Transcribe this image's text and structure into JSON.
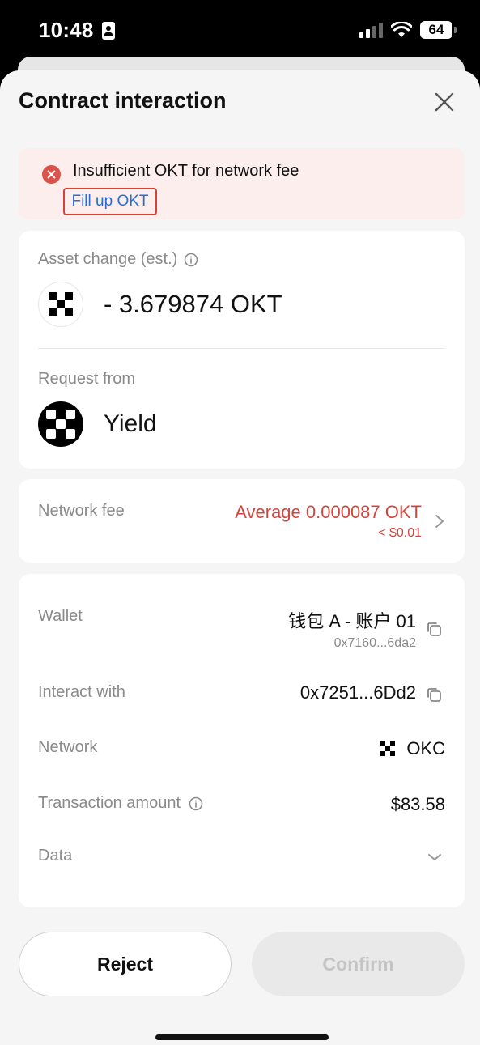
{
  "status_bar": {
    "time": "10:48",
    "battery": "64"
  },
  "header": {
    "title": "Contract interaction"
  },
  "alert": {
    "message": "Insufficient OKT for network fee",
    "link": "Fill up OKT"
  },
  "asset_change": {
    "label": "Asset change (est.)",
    "amount": "- 3.679874 OKT"
  },
  "request": {
    "label": "Request from",
    "name": "Yield"
  },
  "network_fee": {
    "label": "Network fee",
    "value": "Average 0.000087 OKT",
    "usd": "< $0.01"
  },
  "details": {
    "wallet_label": "Wallet",
    "wallet_name": "钱包 A - 账户 01",
    "wallet_address": "0x7160...6da2",
    "interact_label": "Interact with",
    "interact_value": "0x7251...6Dd2",
    "network_label": "Network",
    "network_value": "OKC",
    "amount_label": "Transaction amount",
    "amount_value": "$83.58",
    "data_label": "Data"
  },
  "buttons": {
    "reject": "Reject",
    "confirm": "Confirm"
  },
  "colors": {
    "error": "#d0463f",
    "link": "#2a6bd7",
    "background": "#f5f5f5"
  }
}
